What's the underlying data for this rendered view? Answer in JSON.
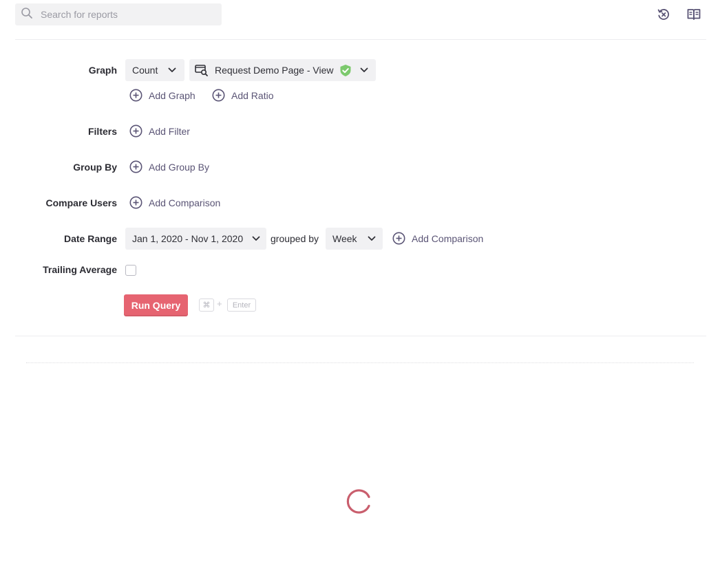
{
  "search": {
    "placeholder": "Search for reports"
  },
  "top_icons": [
    "reset-history-icon",
    "docs-book-icon"
  ],
  "colors": {
    "accent": "#5a5475",
    "run_button": "#e66471",
    "verified": "#7cc96d",
    "spinner": "#c95e6d"
  },
  "graph": {
    "label": "Graph",
    "aggregation": "Count",
    "event": "Request Demo Page - View",
    "add_graph": "Add Graph",
    "add_ratio": "Add Ratio"
  },
  "filters": {
    "label": "Filters",
    "add": "Add Filter"
  },
  "group_by": {
    "label": "Group By",
    "add": "Add Group By"
  },
  "compare_users": {
    "label": "Compare Users",
    "add": "Add Comparison"
  },
  "date_range": {
    "label": "Date Range",
    "value": "Jan 1, 2020 - Nov 1, 2020",
    "grouped_by_label": "grouped by",
    "granularity": "Week",
    "add_comparison": "Add Comparison"
  },
  "trailing_average": {
    "label": "Trailing Average",
    "checked": false
  },
  "run": {
    "label": "Run Query",
    "shortcut_key1": "⌘",
    "shortcut_plus": "+",
    "shortcut_key2": "Enter"
  },
  "results": {
    "state": "loading"
  }
}
